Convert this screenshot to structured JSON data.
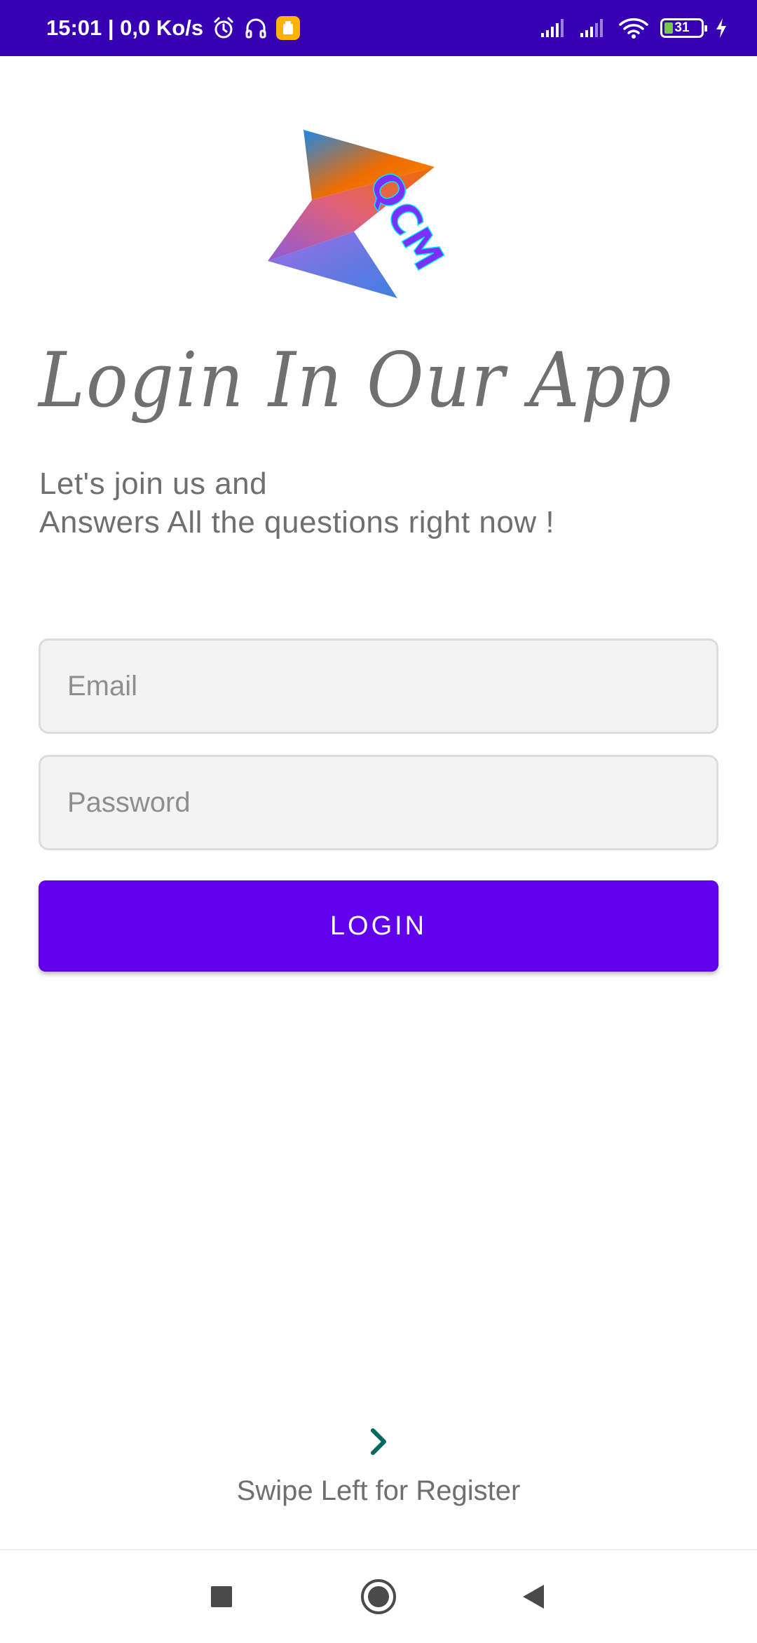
{
  "status_bar": {
    "time_and_speed": "15:01 | 0,0 Ko/s",
    "battery_level": "31",
    "icons": [
      "alarm-icon",
      "headset-icon",
      "app-notification-icon",
      "signal-icon",
      "signal-icon",
      "wifi-icon",
      "battery-icon",
      "charging-icon"
    ],
    "background_color": "#3700b3"
  },
  "logo": {
    "text": "QCM"
  },
  "header": {
    "title": "Login In Our App",
    "subtitle_line1": "Let's join us and",
    "subtitle_line2": "Answers All the questions right now !"
  },
  "form": {
    "email_placeholder": "Email",
    "email_value": "",
    "password_placeholder": "Password",
    "password_value": "",
    "login_label": "LOGIN",
    "accent_color": "#6200ee"
  },
  "footer": {
    "chevron_icon": "chevron-right-icon",
    "chevron_color": "#00695c",
    "swipe_label": "Swipe Left for Register"
  },
  "nav_bar": {
    "buttons": [
      "recents-icon",
      "home-icon",
      "back-icon"
    ]
  }
}
